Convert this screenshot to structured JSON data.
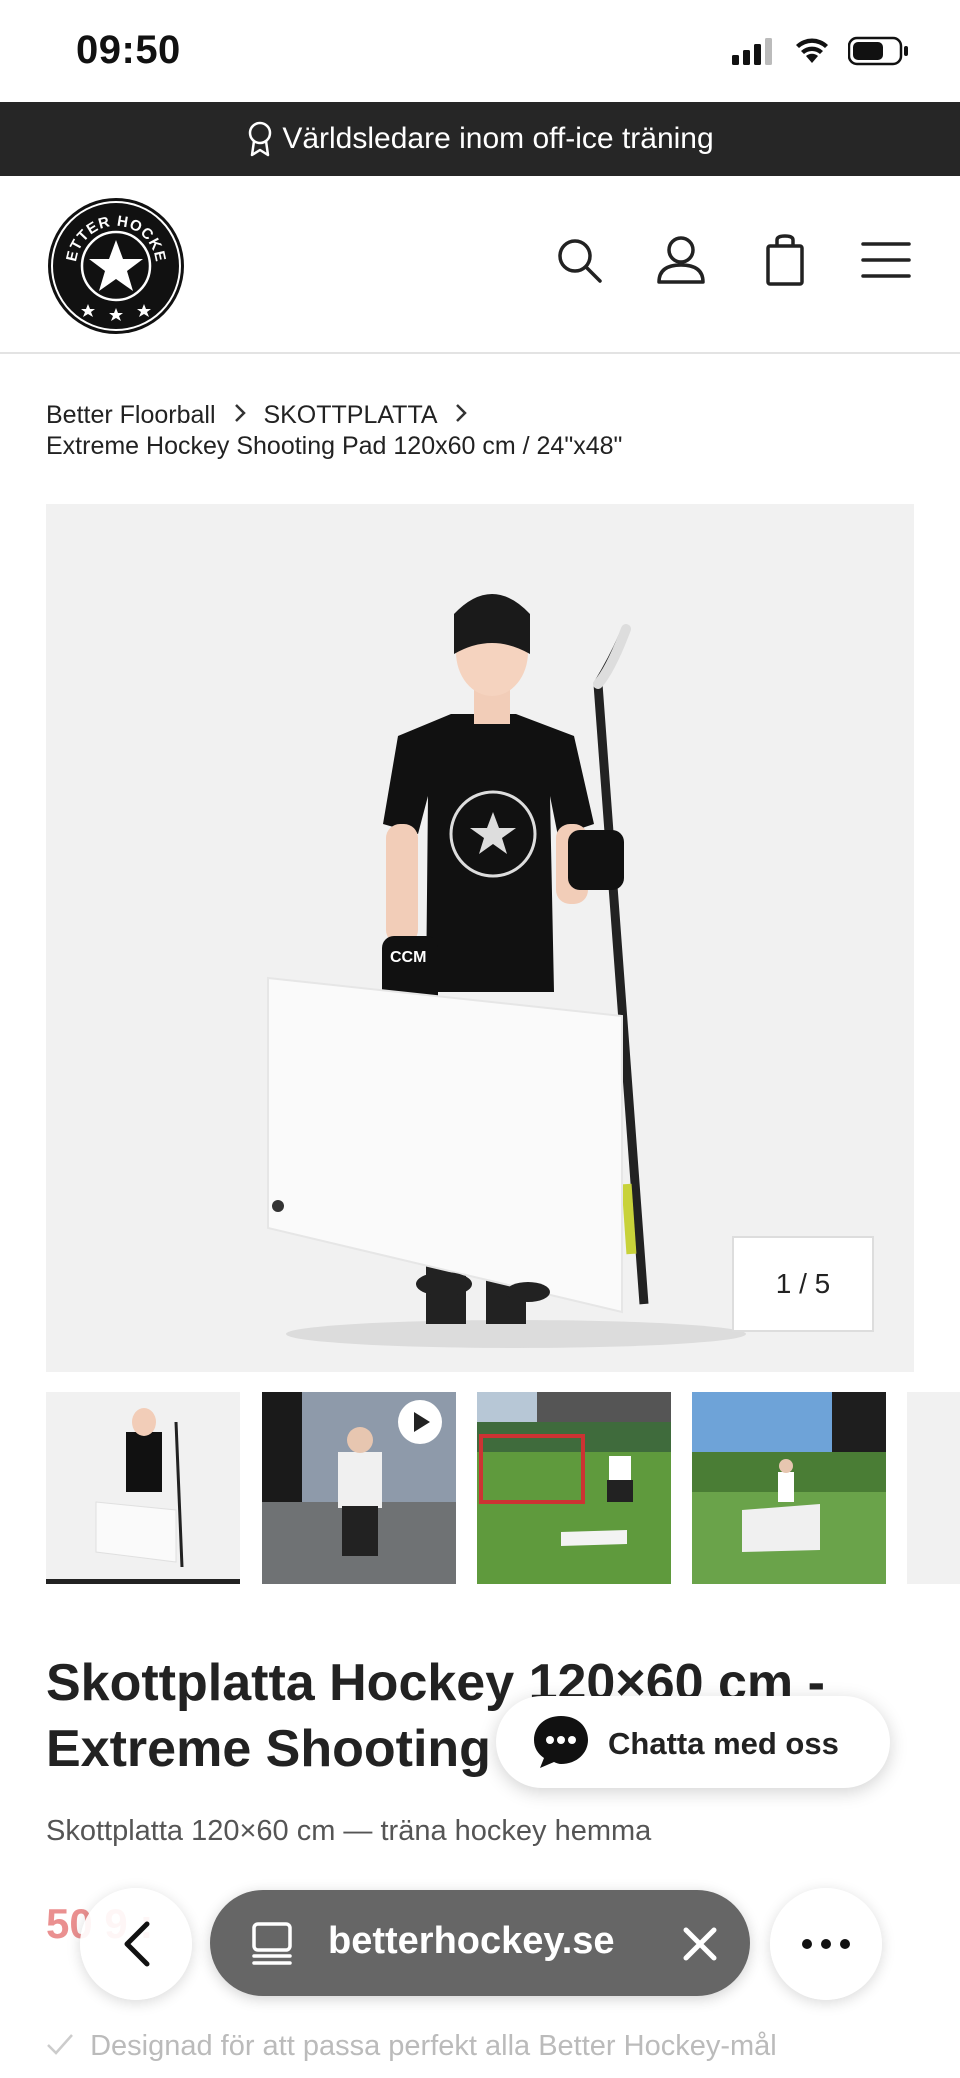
{
  "status_bar": {
    "time": "09:50"
  },
  "promo": {
    "text": "Världsledare inom off-ice träning",
    "icon": "award-ribbon-icon"
  },
  "header": {
    "logo_text": "BETTER HOCKEY",
    "icons": [
      "search-icon",
      "account-icon",
      "cart-icon",
      "menu-icon"
    ]
  },
  "breadcrumb": {
    "items": [
      "Better Floorball",
      "SKOTTPLATTA"
    ],
    "current": "Extreme Hockey Shooting Pad 120x60 cm / 24\"x48\""
  },
  "gallery": {
    "counter": "1 / 5",
    "selected_index": 0,
    "thumb_count_visible": 4
  },
  "product": {
    "title_line1": "Skottplatta Hockey 120×60 cm -",
    "title_line2": "Extreme Shooting P",
    "subtitle": "Skottplatta 120×60 cm — träna hockey hemma",
    "price_partial": "50   9 :",
    "feature_1": "Designad för att passa perfekt alla Better Hockey-mål"
  },
  "chat": {
    "label": "Chatta med oss"
  },
  "browser": {
    "url": "betterhockey.se"
  },
  "colors": {
    "promo_bg": "#262626",
    "price": "#e46c6c",
    "url_bar": "#666666"
  }
}
